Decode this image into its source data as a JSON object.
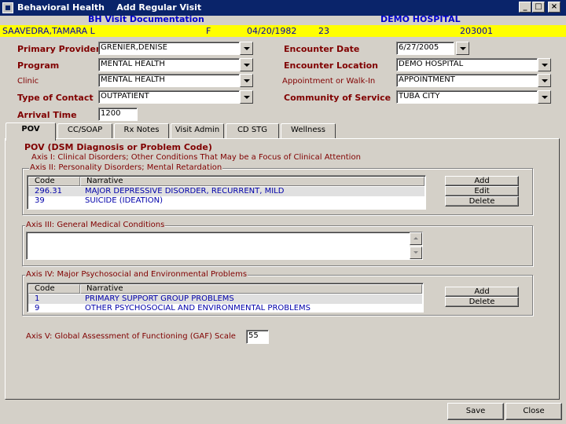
{
  "window": {
    "title": "Behavioral Health    Add Regular Visit",
    "min": "_",
    "max": "□",
    "close": "×"
  },
  "header": {
    "left": "BH Visit Documentation",
    "right": "DEMO HOSPITAL"
  },
  "patient": {
    "name": "SAAVEDRA,TAMARA L",
    "sex": "F",
    "dob": "04/20/1982",
    "age": "23",
    "chart": "203001"
  },
  "form": {
    "primary_provider": {
      "label": "Primary Provider",
      "value": "GRENIER,DENISE"
    },
    "program": {
      "label": "Program",
      "value": "MENTAL HEALTH"
    },
    "clinic": {
      "label": "Clinic",
      "value": "MENTAL HEALTH"
    },
    "type_of_contact": {
      "label": "Type of Contact",
      "value": "OUTPATIENT"
    },
    "arrival_time": {
      "label": "Arrival Time",
      "value": "1200"
    },
    "encounter_date": {
      "label": "Encounter Date",
      "value": "6/27/2005"
    },
    "encounter_location": {
      "label": "Encounter Location",
      "value": "DEMO HOSPITAL"
    },
    "appointment": {
      "label": "Appointment or Walk-In",
      "value": "APPOINTMENT"
    },
    "community": {
      "label": "Community of Service",
      "value": "TUBA CITY"
    }
  },
  "tabs": [
    "POV",
    "CC/SOAP",
    "Rx Notes",
    "Visit Admin",
    "CD STG",
    "Wellness"
  ],
  "pov": {
    "title": "POV (DSM Diagnosis or Problem Code)",
    "axis1": "Axis I:  Clinical Disorders; Other Conditions That May be a Focus of Clinical Attention",
    "axis2": "Axis II:  Personality Disorders; Mental Retardation",
    "axis3": "Axis III:  General Medical Conditions",
    "axis4": "Axis IV:  Major Psychosocial and Environmental Problems",
    "axis5": "Axis V:  Global Assessment of Functioning (GAF) Scale",
    "gaf_value": "55",
    "grid_headers": {
      "code": "Code",
      "narrative": "Narrative"
    },
    "dx_rows": [
      {
        "code": "296.31",
        "narrative": "MAJOR DEPRESSIVE DISORDER, RECURRENT, MILD"
      },
      {
        "code": "39",
        "narrative": "SUICIDE (IDEATION)"
      }
    ],
    "psych_rows": [
      {
        "code": "1",
        "narrative": "PRIMARY SUPPORT GROUP PROBLEMS"
      },
      {
        "code": "9",
        "narrative": "OTHER PSYCHOSOCIAL AND ENVIRONMENTAL PROBLEMS"
      }
    ],
    "buttons": {
      "add": "Add",
      "edit": "Edit",
      "delete": "Delete"
    }
  },
  "footer": {
    "save": "Save",
    "close": "Close"
  }
}
